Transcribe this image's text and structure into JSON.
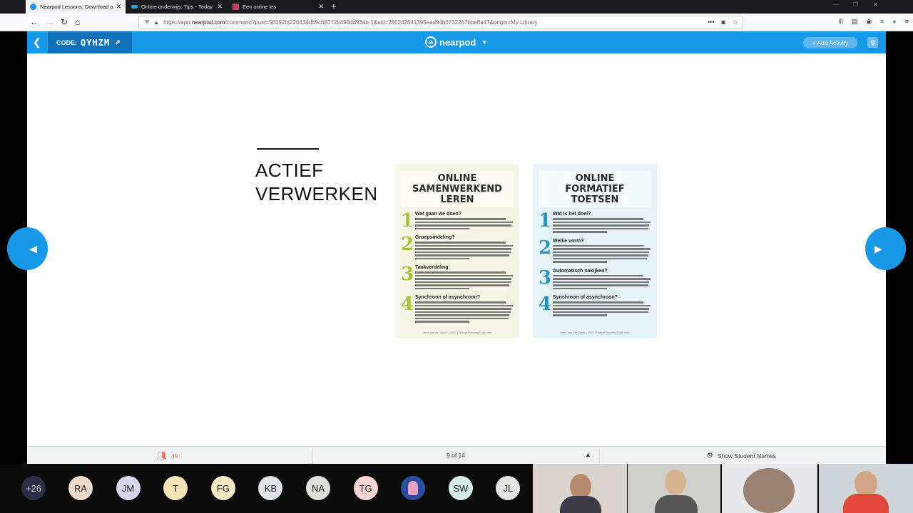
{
  "browser": {
    "tabs": [
      {
        "label": "Nearpod Lessons: Download an",
        "active": true,
        "color": "#1799e8"
      },
      {
        "label": "Online onderwijs: Tips - Today",
        "active": false,
        "color": "#2aa6e6"
      },
      {
        "label": "Een online les",
        "active": false,
        "color": "#c83a6a"
      }
    ],
    "url_prefix": "https://app.",
    "url_host": "nearpod.com",
    "url_rest": "/command?puid=58392fd220434d69cb8772b498dd93ab-1&sid=2802d2841395ead94b0732267bbe8a47&origin=My Library"
  },
  "nearpod": {
    "code_label": "CODE:",
    "code_value": "QYHZM",
    "logo_text": "nearpod",
    "add_activity": "+ Add Activity",
    "s_badge": "S"
  },
  "slide": {
    "title_line1": "ACTIEF",
    "title_line2": "VERWERKEN",
    "poster_left": {
      "title_lines": [
        "ONLINE",
        "SAMENWERKEND",
        "LEREN"
      ],
      "items": [
        {
          "num": "1",
          "head": "Wat gaan we doen?",
          "lines": 4
        },
        {
          "num": "2",
          "head": "Groepsindeling?",
          "lines": 6
        },
        {
          "num": "3",
          "head": "Taakverdeling",
          "lines": 6
        },
        {
          "num": "4",
          "head": "Synchroon of asynchroon?",
          "lines": 7
        }
      ],
      "footer": "Irene van der Spoel | 2020 | TodaysTeachingTools.com"
    },
    "poster_right": {
      "title_lines": [
        "ONLINE",
        "FORMATIEF",
        "TOETSEN"
      ],
      "items": [
        {
          "num": "1",
          "head": "Wat is het doel?",
          "lines": 5
        },
        {
          "num": "2",
          "head": "Welke vorm?",
          "lines": 6
        },
        {
          "num": "3",
          "head": "Automatisch nakijken?",
          "lines": 5
        },
        {
          "num": "4",
          "head": "Synchroon of asynchroon?",
          "lines": 5
        }
      ],
      "footer": "Irene van der Spoel | 2020 | TodaysTeachingTools.com"
    }
  },
  "footer": {
    "students_count": "49",
    "page_indicator": "9 of 14",
    "show_names": "Show Student Names"
  },
  "participants": {
    "overflow": "+26",
    "avatars": [
      {
        "initials": "RA",
        "color": "#efd9c8"
      },
      {
        "initials": "JM",
        "color": "#d8d6ee"
      },
      {
        "initials": "T",
        "color": "#f6e4b9"
      },
      {
        "initials": "FG",
        "color": "#f5e6c4"
      },
      {
        "initials": "KB",
        "color": "#dfe3ec"
      },
      {
        "initials": "NA",
        "color": "#dedfd9"
      },
      {
        "initials": "TG",
        "color": "#f6d4d2"
      },
      {
        "initials": "",
        "color": "#2b4fa0"
      },
      {
        "initials": "SW",
        "color": "#d6ece9"
      },
      {
        "initials": "JL",
        "color": "#e3e4e2"
      }
    ]
  }
}
